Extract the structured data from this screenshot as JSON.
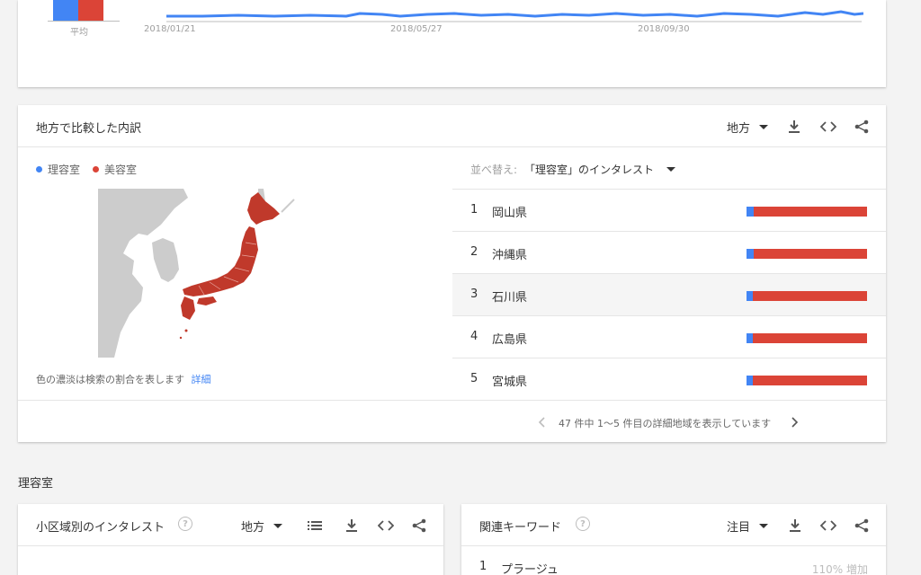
{
  "colors": {
    "series_a": "#4285f4",
    "series_b": "#db4437",
    "link": "#4285f4"
  },
  "top_chart": {
    "average_label": "平均",
    "x_ticks": [
      "2018/01/21",
      "2018/05/27",
      "2018/09/30"
    ]
  },
  "region_card": {
    "title": "地方で比較した内訳",
    "geo_select": "地方",
    "legend": [
      {
        "name": "理容室",
        "color": "#4285f4"
      },
      {
        "name": "美容室",
        "color": "#db4437"
      }
    ],
    "sort_label": "並べ替え:",
    "sort_value": "「理容室」のインタレスト",
    "map_note": "色の濃淡は検索の割合を表します",
    "map_note_link": "詳細",
    "rows": [
      {
        "rank": "1",
        "name": "岡山県",
        "share_a": 6
      },
      {
        "rank": "2",
        "name": "沖縄県",
        "share_a": 6
      },
      {
        "rank": "3",
        "name": "石川県",
        "share_a": 5
      },
      {
        "rank": "4",
        "name": "広島県",
        "share_a": 5
      },
      {
        "rank": "5",
        "name": "宮城県",
        "share_a": 5
      }
    ],
    "pagination": "47 件中 1〜5 件目の詳細地域を表示しています"
  },
  "section_title": "理容室",
  "subregion_card": {
    "title": "小区域別のインタレスト",
    "help": "?",
    "geo_select": "地方"
  },
  "related_card": {
    "title": "関連キーワード",
    "help": "?",
    "select": "注目",
    "first_item": {
      "rank": "1",
      "name": "プラージュ",
      "value": "110% 増加"
    }
  }
}
